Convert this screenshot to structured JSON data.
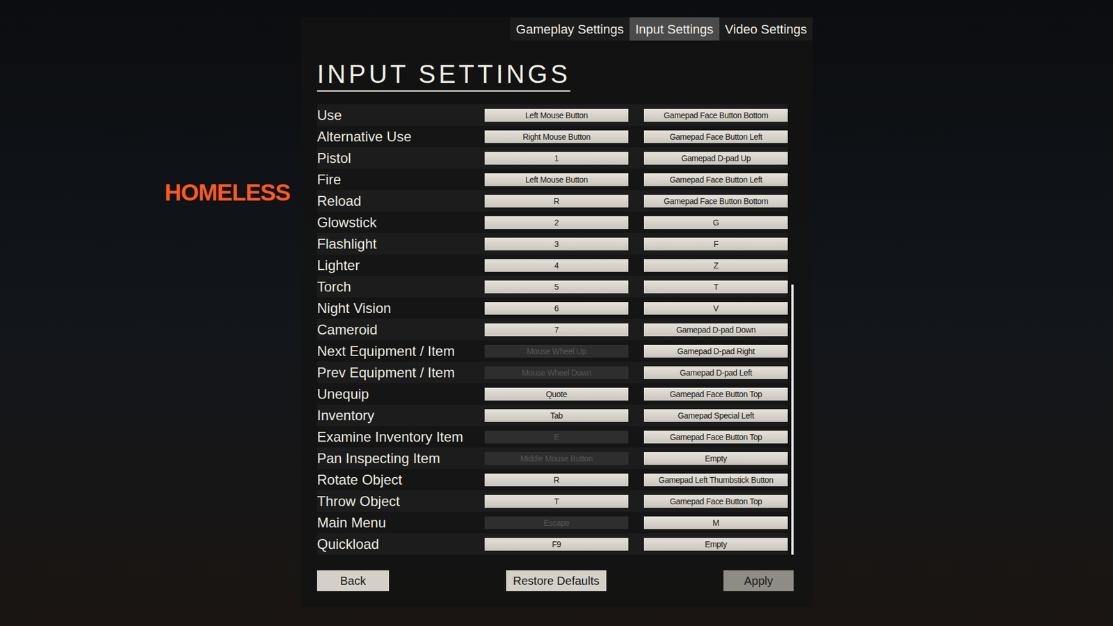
{
  "logo": {
    "text": "HOMELESS"
  },
  "tabs": [
    {
      "label": "Gameplay Settings",
      "selected": false
    },
    {
      "label": "Input Settings",
      "selected": true
    },
    {
      "label": "Video Settings",
      "selected": false
    }
  ],
  "title": "INPUT SETTINGS",
  "rows": [
    {
      "label": "Use",
      "primary": {
        "text": "Left Mouse Button",
        "disabled": false
      },
      "secondary": {
        "text": "Gamepad Face Button Bottom",
        "disabled": false
      }
    },
    {
      "label": "Alternative Use",
      "primary": {
        "text": "Right Mouse Button",
        "disabled": false
      },
      "secondary": {
        "text": "Gamepad Face Button Left",
        "disabled": false
      }
    },
    {
      "label": "Pistol",
      "primary": {
        "text": "1",
        "disabled": false
      },
      "secondary": {
        "text": "Gamepad D-pad Up",
        "disabled": false
      }
    },
    {
      "label": "Fire",
      "primary": {
        "text": "Left Mouse Button",
        "disabled": false
      },
      "secondary": {
        "text": "Gamepad Face Button Left",
        "disabled": false
      }
    },
    {
      "label": "Reload",
      "primary": {
        "text": "R",
        "disabled": false
      },
      "secondary": {
        "text": "Gamepad Face Button Bottom",
        "disabled": false
      }
    },
    {
      "label": "Glowstick",
      "primary": {
        "text": "2",
        "disabled": false
      },
      "secondary": {
        "text": "G",
        "disabled": false
      }
    },
    {
      "label": "Flashlight",
      "primary": {
        "text": "3",
        "disabled": false
      },
      "secondary": {
        "text": "F",
        "disabled": false
      }
    },
    {
      "label": "Lighter",
      "primary": {
        "text": "4",
        "disabled": false
      },
      "secondary": {
        "text": "Z",
        "disabled": false
      }
    },
    {
      "label": "Torch",
      "primary": {
        "text": "5",
        "disabled": false
      },
      "secondary": {
        "text": "T",
        "disabled": false
      }
    },
    {
      "label": "Night Vision",
      "primary": {
        "text": "6",
        "disabled": false
      },
      "secondary": {
        "text": "V",
        "disabled": false
      }
    },
    {
      "label": "Cameroid",
      "primary": {
        "text": "7",
        "disabled": false
      },
      "secondary": {
        "text": "Gamepad D-pad Down",
        "disabled": false
      }
    },
    {
      "label": "Next Equipment / Item",
      "primary": {
        "text": "Mouse Wheel Up",
        "disabled": true
      },
      "secondary": {
        "text": "Gamepad D-pad Right",
        "disabled": false
      }
    },
    {
      "label": "Prev Equipment / Item",
      "primary": {
        "text": "Mouse Wheel Down",
        "disabled": true
      },
      "secondary": {
        "text": "Gamepad D-pad Left",
        "disabled": false
      }
    },
    {
      "label": "Unequip",
      "primary": {
        "text": "Quote",
        "disabled": false
      },
      "secondary": {
        "text": "Gamepad Face Button Top",
        "disabled": false
      }
    },
    {
      "label": "Inventory",
      "primary": {
        "text": "Tab",
        "disabled": false
      },
      "secondary": {
        "text": "Gamepad Special Left",
        "disabled": false
      }
    },
    {
      "label": "Examine Inventory Item",
      "primary": {
        "text": "E",
        "disabled": true
      },
      "secondary": {
        "text": "Gamepad Face Button Top",
        "disabled": false
      }
    },
    {
      "label": "Pan Inspecting Item",
      "primary": {
        "text": "Middle Mouse Button",
        "disabled": true
      },
      "secondary": {
        "text": "Empty",
        "disabled": false
      }
    },
    {
      "label": "Rotate Object",
      "primary": {
        "text": "R",
        "disabled": false
      },
      "secondary": {
        "text": "Gamepad Left Thumbstick Button",
        "disabled": false
      }
    },
    {
      "label": "Throw Object",
      "primary": {
        "text": "T",
        "disabled": false
      },
      "secondary": {
        "text": "Gamepad Face Button Top",
        "disabled": false
      }
    },
    {
      "label": "Main Menu",
      "primary": {
        "text": "Escape",
        "disabled": true
      },
      "secondary": {
        "text": "M",
        "disabled": false
      }
    },
    {
      "label": "Quickload",
      "primary": {
        "text": "F9",
        "disabled": false
      },
      "secondary": {
        "text": "Empty",
        "disabled": false
      }
    }
  ],
  "scrollbar": {
    "level": 1,
    "size": 0.6
  },
  "buttons": [
    "Back",
    "Restore Defaults",
    "Apply"
  ]
}
